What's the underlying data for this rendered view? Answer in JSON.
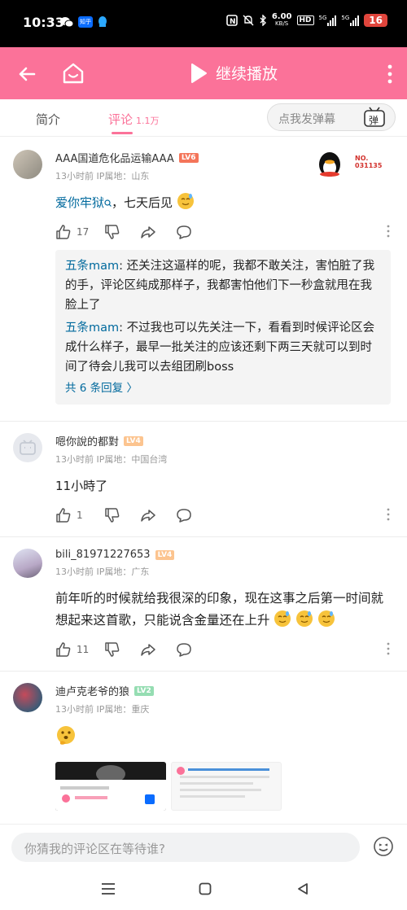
{
  "status_bar": {
    "time": "10:33",
    "badge_app": "知乎",
    "net_speed_value": "6.00",
    "net_speed_unit": "KB/S",
    "sim1": "5G",
    "sim2": "5G",
    "hd_label": "HD",
    "battery": "16"
  },
  "header": {
    "play_label": "继续播放"
  },
  "tabs": {
    "intro": "简介",
    "comments": "评论",
    "comments_count": "1.1万",
    "danmaku_placeholder": "点我发弹幕",
    "danmaku_icon_label": "弹"
  },
  "comments": [
    {
      "username": "AAA国道危化品运输AAA",
      "level": "LV6",
      "level_color": "#f4755a",
      "meta": "13小时前 IP属地：山东",
      "badge_no_label": "NO.",
      "badge_no": "031135",
      "text_link": "爱你牢狱",
      "text_rest": "，七天后见",
      "likes": "17",
      "replies": [
        {
          "name": "五条mam",
          "text": ": 还关注这逼样的呢，我都不敢关注，害怕脏了我的手，评论区纯成那样子，我都害怕他们下一秒盒就甩在我脸上了"
        },
        {
          "name": "五条mam",
          "text": ": 不过我也可以先关注一下，看看到时候评论区会成什么样子，最早一批关注的应该还剩下两三天就可以到时间了待会儿我可以去组团刷boss"
        }
      ],
      "more_replies": "共 6 条回复 〉"
    },
    {
      "username": "嗯你說的都對",
      "level": "LV4",
      "level_color": "#fcc48f",
      "meta": "13小时前 IP属地：中国台湾",
      "text": "11小時了",
      "likes": "1"
    },
    {
      "username": "bili_81971227653",
      "level": "LV4",
      "level_color": "#fcc48f",
      "meta": "13小时前 IP属地：广东",
      "text": "前年听的时候就给我很深的印象，现在这事之后第一时间就想起来这首歌，只能说含金量还在上升",
      "likes": "11"
    },
    {
      "username": "迪卢克老爷的狼",
      "level": "LV2",
      "level_color": "#95ddb2",
      "meta": "13小时前 IP属地：重庆"
    }
  ],
  "bottom": {
    "comment_placeholder": "你猜我的评论区在等待谁?"
  },
  "colors": {
    "brand_pink": "#fb7299",
    "link_blue": "#00699d"
  }
}
